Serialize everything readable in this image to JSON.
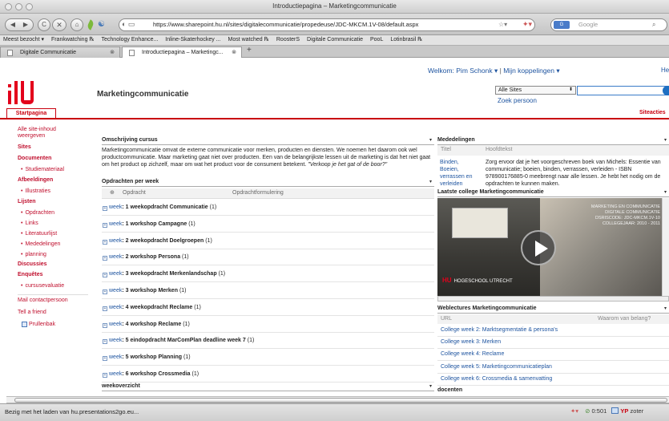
{
  "window": {
    "title": "Introductiepagina – Marketingcommunicatie"
  },
  "nav": {
    "back_glyph": "◀",
    "forward_glyph": "▶",
    "reload_glyph": "C",
    "stop_glyph": "✕",
    "home_glyph": "⌂",
    "url": "https://www.sharepoint.hu.nl/sites/digitalecommunicatie/propedeuse/JDC-MKCM.1V-08/default.aspx",
    "star_glyph": "☆▾",
    "search_placeholder": "Google",
    "search_engine_label": "G"
  },
  "bookmarks": [
    "Meest bezocht ▾",
    "Frankwatching ℞",
    "Technology Enhance...",
    "Inline-Skaterhockey ...",
    "Most watched ℞",
    "RoosterS",
    "Digitale Communicatie",
    "PooL",
    "Lotinbrasil ℞"
  ],
  "tabs": [
    {
      "label": "Digitale Communicatie",
      "active": false
    },
    {
      "label": "Introductiepagina – Marketingc...",
      "active": true
    }
  ],
  "tab_close_glyph": "⊗",
  "tab_new_glyph": "+",
  "header": {
    "welcome": "Welkom: Pim Schonk ▾",
    "separator": "|",
    "my_links": "Mijn koppelingen ▾",
    "help": "He",
    "site_title": "Marketingcommunicatie",
    "scope_value": "Alle Sites",
    "scope_arrow": "⬍",
    "find_person": "Zoek persoon",
    "home_tab": "Startpagina",
    "site_actions": "Siteacties"
  },
  "leftnav": [
    {
      "label": "Alle site-inhoud weergeven",
      "kind": "link"
    },
    {
      "label": "Sites",
      "kind": "header"
    },
    {
      "label": "Documenten",
      "kind": "header"
    },
    {
      "label": "Studiemateriaal",
      "kind": "sub"
    },
    {
      "label": "Afbeeldingen",
      "kind": "header"
    },
    {
      "label": "Illustraties",
      "kind": "sub"
    },
    {
      "label": "Lijsten",
      "kind": "header"
    },
    {
      "label": "Opdrachten",
      "kind": "sub"
    },
    {
      "label": "Links",
      "kind": "sub"
    },
    {
      "label": "Literatuurlijst",
      "kind": "sub"
    },
    {
      "label": "Mededelingen",
      "kind": "sub"
    },
    {
      "label": "planning",
      "kind": "sub"
    },
    {
      "label": "Discussies",
      "kind": "header"
    },
    {
      "label": "Enquêtes",
      "kind": "header"
    },
    {
      "label": "cursusevaluatie",
      "kind": "sub"
    },
    {
      "label": "Mail contactpersoon",
      "kind": "link"
    },
    {
      "label": "Tell a friend",
      "kind": "link"
    },
    {
      "label": "Prullenbak",
      "kind": "link"
    }
  ],
  "course": {
    "header": "Omschrijving cursus",
    "menu_glyph": "▾",
    "text": "Marketingcommunicatie omvat de externe communicatie voor merken, producten en diensten. We noemen het daarom ook wel productcommunicatie. Maar marketing gaat niet over producten. Een van de belangrijkste lessen uit de marketing is dat het niet gaat om het product op zichzelf, maar om wat het product voor de consument betekent.",
    "quote": "\"Verkoop je het gat of de boor?\""
  },
  "assignments": {
    "header": "Opdrachten per week",
    "col1": "Opdracht",
    "col2": "Opdrachtformulering",
    "group_link": "week",
    "plus_glyph": "+",
    "rows": [
      ": 1 weekopdracht Communicatie",
      ": 1 workshop Campagne",
      ": 2 weekopdracht Doelgroepen",
      ": 2 workshop Persona",
      ": 3 weekopdracht Merkenlandschap",
      ": 3 workshop Merken",
      ": 4 weekopdracht Reclame",
      ": 4 workshop Reclame",
      ": 5 eindopdracht MarComPlan deadline week 7",
      ": 5 workshop Planning",
      ": 6 workshop Crossmedia"
    ],
    "counts": [
      "(1)",
      "(1)",
      "(1)",
      "(1)",
      "(1)",
      "(1)",
      "(1)",
      "(1)",
      "(1)",
      "(1)",
      "(1)"
    ],
    "next_header": "weekoverzicht"
  },
  "announcements": {
    "header": "Mededelingen",
    "col1": "Titel",
    "col2": "Hoofdtekst",
    "item_title": "Binden, Boeien, verrassen en verleiden",
    "item_body": "Zorg ervoor dat je het voorgeschreven boek van Michels: Essentie van communicatie; boeien, binden, verrassen, verleiden - ISBN 978900176885-0 meebrengt naar alle lessen. Je hebt het nodig om de opdrachten te kunnen maken."
  },
  "lecture": {
    "header": "Laatste college Marketingcommunicatie",
    "caption": [
      "MARKETING EN COMMUNICATIE",
      "DIGITALE COMMUNICATIE",
      "DSRISCODE: JDC-MKCM.1V-10",
      "COLLEGEJAAR: 2010 - 2011"
    ],
    "logo_text": "HU",
    "logo_sub": "HOGESCHOOL UTRECHT"
  },
  "weblectures": {
    "header": "Weblectures Marketingcommunicatie",
    "col1": "URL",
    "col2": "Waarom van belang?",
    "items": [
      "College week 2: Marktsegmentatie & persona's",
      "College week 3: Merken",
      "College week 4: Reclame",
      "College week 5: Marketingcommunicatieplan",
      "College week 6: Crossmedia & samenvatting"
    ],
    "next_header": "docenten"
  },
  "status": {
    "text": "Bezig met het laden van hu.presentations2go.eu...",
    "timer": "0:501",
    "yp_text": "YP",
    "zotero": "zoter"
  },
  "colors": {
    "hu_red": "#e3001b",
    "link_blue": "#1f55a0",
    "nav_red": "#c0102e"
  }
}
